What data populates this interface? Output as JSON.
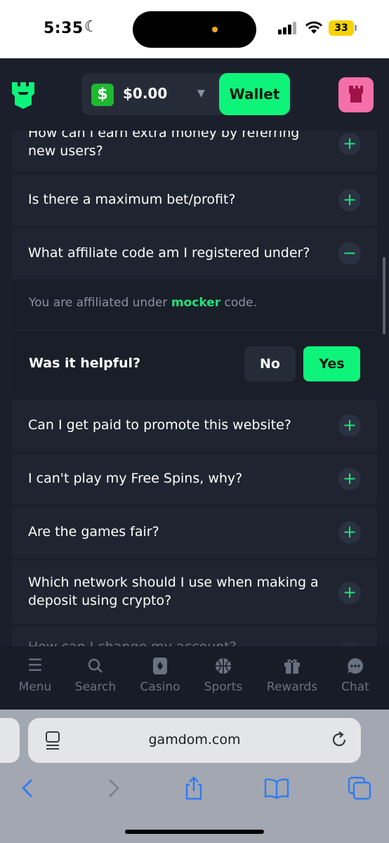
{
  "status": {
    "time": "5:35",
    "battery": "33"
  },
  "header": {
    "balance": "$0.00",
    "currency_symbol": "$",
    "wallet_label": "Wallet"
  },
  "faq": {
    "items": [
      {
        "question": "How can I earn extra money by referring new users?"
      },
      {
        "question": "Is there a maximum bet/profit?"
      },
      {
        "question": "What affiliate code am I registered under?"
      },
      {
        "question": "Can I get paid to promote this website?"
      },
      {
        "question": "I can't play my Free Spins, why?"
      },
      {
        "question": "Are the games fair?"
      },
      {
        "question": "Which network should I use when making a deposit using crypto?"
      },
      {
        "question": "How can I change my account?"
      }
    ],
    "expand_symbol": "+",
    "collapse_symbol": "−",
    "answer": {
      "prefix": "You are affiliated under ",
      "highlight": "mocker",
      "suffix": " code."
    },
    "helpful": {
      "label": "Was it helpful?",
      "no": "No",
      "yes": "Yes"
    }
  },
  "bottom_nav": [
    {
      "label": "Menu",
      "icon": "menu-icon"
    },
    {
      "label": "Search",
      "icon": "search-icon"
    },
    {
      "label": "Casino",
      "icon": "casino-icon"
    },
    {
      "label": "Sports",
      "icon": "sports-icon"
    },
    {
      "label": "Rewards",
      "icon": "rewards-icon"
    },
    {
      "label": "Chat",
      "icon": "chat-icon"
    }
  ],
  "browser": {
    "url": "gamdom.com"
  },
  "colors": {
    "accent": "#0ef47b",
    "background": "#1b1f2b",
    "card": "#1f2430",
    "avatar": "#f56fa8",
    "browser_blue": "#2f7bf5"
  }
}
